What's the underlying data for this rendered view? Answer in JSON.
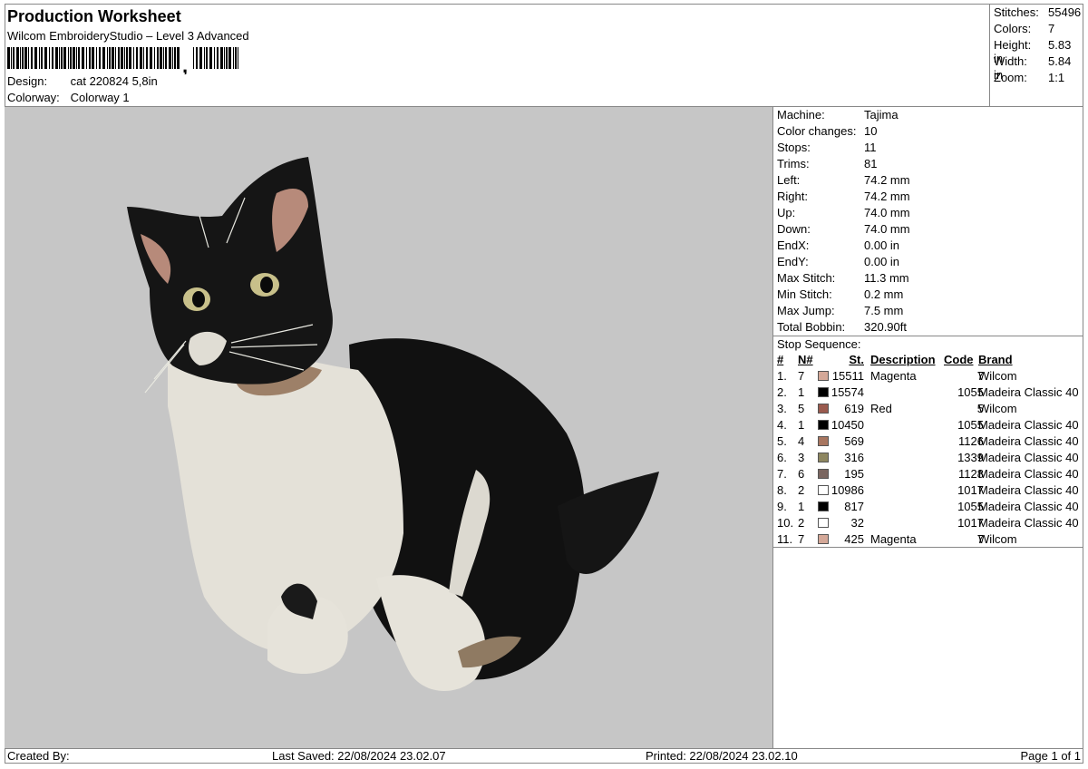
{
  "header": {
    "title": "Production Worksheet",
    "subtitle": "Wilcom EmbroideryStudio – Level 3 Advanced",
    "barcode_suffix": ",",
    "design_label": "Design:",
    "design_value": "cat 220824 5,8in",
    "colorway_label": "Colorway:",
    "colorway_value": "Colorway 1"
  },
  "summary": [
    {
      "label": "Stitches:",
      "value": "55496"
    },
    {
      "label": "Colors:",
      "value": "7"
    },
    {
      "label": "Height:",
      "value": "5.83 in"
    },
    {
      "label": "Width:",
      "value": "5.84 in"
    },
    {
      "label": "Zoom:",
      "value": "1:1"
    }
  ],
  "machine_info": [
    {
      "label": "Machine:",
      "value": "Tajima"
    },
    {
      "label": "Color changes:",
      "value": "10"
    },
    {
      "label": "Stops:",
      "value": "11"
    },
    {
      "label": "Trims:",
      "value": "81"
    },
    {
      "label": "Left:",
      "value": "74.2 mm"
    },
    {
      "label": "Right:",
      "value": "74.2 mm"
    },
    {
      "label": "Up:",
      "value": "74.0 mm"
    },
    {
      "label": "Down:",
      "value": "74.0 mm"
    },
    {
      "label": "EndX:",
      "value": "0.00 in"
    },
    {
      "label": "EndY:",
      "value": "0.00 in"
    },
    {
      "label": "Max Stitch:",
      "value": "11.3 mm"
    },
    {
      "label": "Min Stitch:",
      "value": "0.2 mm"
    },
    {
      "label": "Max Jump:",
      "value": "7.5 mm"
    },
    {
      "label": "Total Bobbin:",
      "value": "320.90ft"
    }
  ],
  "stop_sequence": {
    "title": "Stop Sequence:",
    "headers": {
      "num": "#",
      "n": "N#",
      "st": "St.",
      "desc": "Description",
      "code": "Code",
      "brand": "Brand"
    },
    "rows": [
      {
        "num": "1.",
        "n": "7",
        "color": "#d4a898",
        "st": "15511",
        "desc": "Magenta",
        "code": "7",
        "brand": "Wilcom"
      },
      {
        "num": "2.",
        "n": "1",
        "color": "#000000",
        "st": "15574",
        "desc": "",
        "code": "1055",
        "brand": "Madeira Classic 40"
      },
      {
        "num": "3.",
        "n": "5",
        "color": "#9a5a4e",
        "st": "619",
        "desc": "Red",
        "code": "5",
        "brand": "Wilcom"
      },
      {
        "num": "4.",
        "n": "1",
        "color": "#000000",
        "st": "10450",
        "desc": "",
        "code": "1055",
        "brand": "Madeira Classic 40"
      },
      {
        "num": "5.",
        "n": "4",
        "color": "#a87660",
        "st": "569",
        "desc": "",
        "code": "1126",
        "brand": "Madeira Classic 40"
      },
      {
        "num": "6.",
        "n": "3",
        "color": "#8d8660",
        "st": "316",
        "desc": "",
        "code": "1339",
        "brand": "Madeira Classic 40"
      },
      {
        "num": "7.",
        "n": "6",
        "color": "#7a6660",
        "st": "195",
        "desc": "",
        "code": "1128",
        "brand": "Madeira Classic 40"
      },
      {
        "num": "8.",
        "n": "2",
        "color": "#ffffff",
        "st": "10986",
        "desc": "",
        "code": "1017",
        "brand": "Madeira Classic 40"
      },
      {
        "num": "9.",
        "n": "1",
        "color": "#000000",
        "st": "817",
        "desc": "",
        "code": "1055",
        "brand": "Madeira Classic 40"
      },
      {
        "num": "10.",
        "n": "2",
        "color": "#ffffff",
        "st": "32",
        "desc": "",
        "code": "1017",
        "brand": "Madeira Classic 40"
      },
      {
        "num": "11.",
        "n": "7",
        "color": "#d4a898",
        "st": "425",
        "desc": "Magenta",
        "code": "7",
        "brand": "Wilcom"
      }
    ]
  },
  "footer": {
    "created_by": "Created By:",
    "last_saved": "Last Saved: 22/08/2024 23.02.07",
    "printed": "Printed: 22/08/2024 23.02.10",
    "page": "Page 1 of 1"
  },
  "design_preview": {
    "subject": "cat-embroidery-icon",
    "background": "#c6c6c6"
  }
}
